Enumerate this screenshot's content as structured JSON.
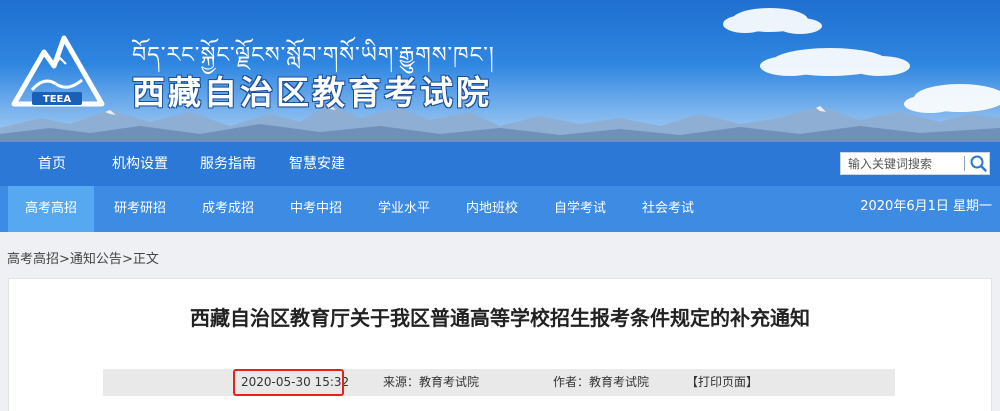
{
  "header": {
    "tibetan_name": "བོད་རང་སྐྱོང་ལྗོངས་སློབ་གསོ་ཡིག་རྒྱུགས་ཁང་།",
    "site_name": "西藏自治区教育考试院",
    "logo_text": "TEEA",
    "banner_colors": {
      "sky_top": "#1f6fd0",
      "sky_bottom": "#a9cdf2",
      "mountains": "#6f90b8"
    }
  },
  "primary_nav": {
    "items": [
      {
        "label": "首页"
      },
      {
        "label": "机构设置"
      },
      {
        "label": "服务指南"
      },
      {
        "label": "智慧安建"
      }
    ],
    "search": {
      "placeholder": "输入关键词搜索",
      "icon": "search-icon"
    }
  },
  "secondary_nav": {
    "items": [
      {
        "label": "高考高招",
        "active": true
      },
      {
        "label": "研考研招",
        "active": false
      },
      {
        "label": "成考成招",
        "active": false
      },
      {
        "label": "中考中招",
        "active": false
      },
      {
        "label": "学业水平",
        "active": false
      },
      {
        "label": "内地班校",
        "active": false
      },
      {
        "label": "自学考试",
        "active": false
      },
      {
        "label": "社会考试",
        "active": false
      }
    ],
    "current_date": "2020年6月1日 星期一"
  },
  "breadcrumb": {
    "items": [
      {
        "label": "高考高招"
      },
      {
        "label": "通知公告"
      },
      {
        "label": "正文"
      }
    ],
    "separator": ">"
  },
  "article": {
    "title": "西藏自治区教育厅关于我区普通高等学校招生报考条件规定的补充通知",
    "published": "2020-05-30 15:32",
    "source": "来源：教育考试院",
    "author": "作者：教育考试院",
    "print_label": "【打印页面】"
  },
  "colors": {
    "nav_primary": "#2b78d6",
    "nav_secondary": "#3d8be3",
    "nav_active": "#56a9f0",
    "highlight_box": "#e2231a"
  }
}
